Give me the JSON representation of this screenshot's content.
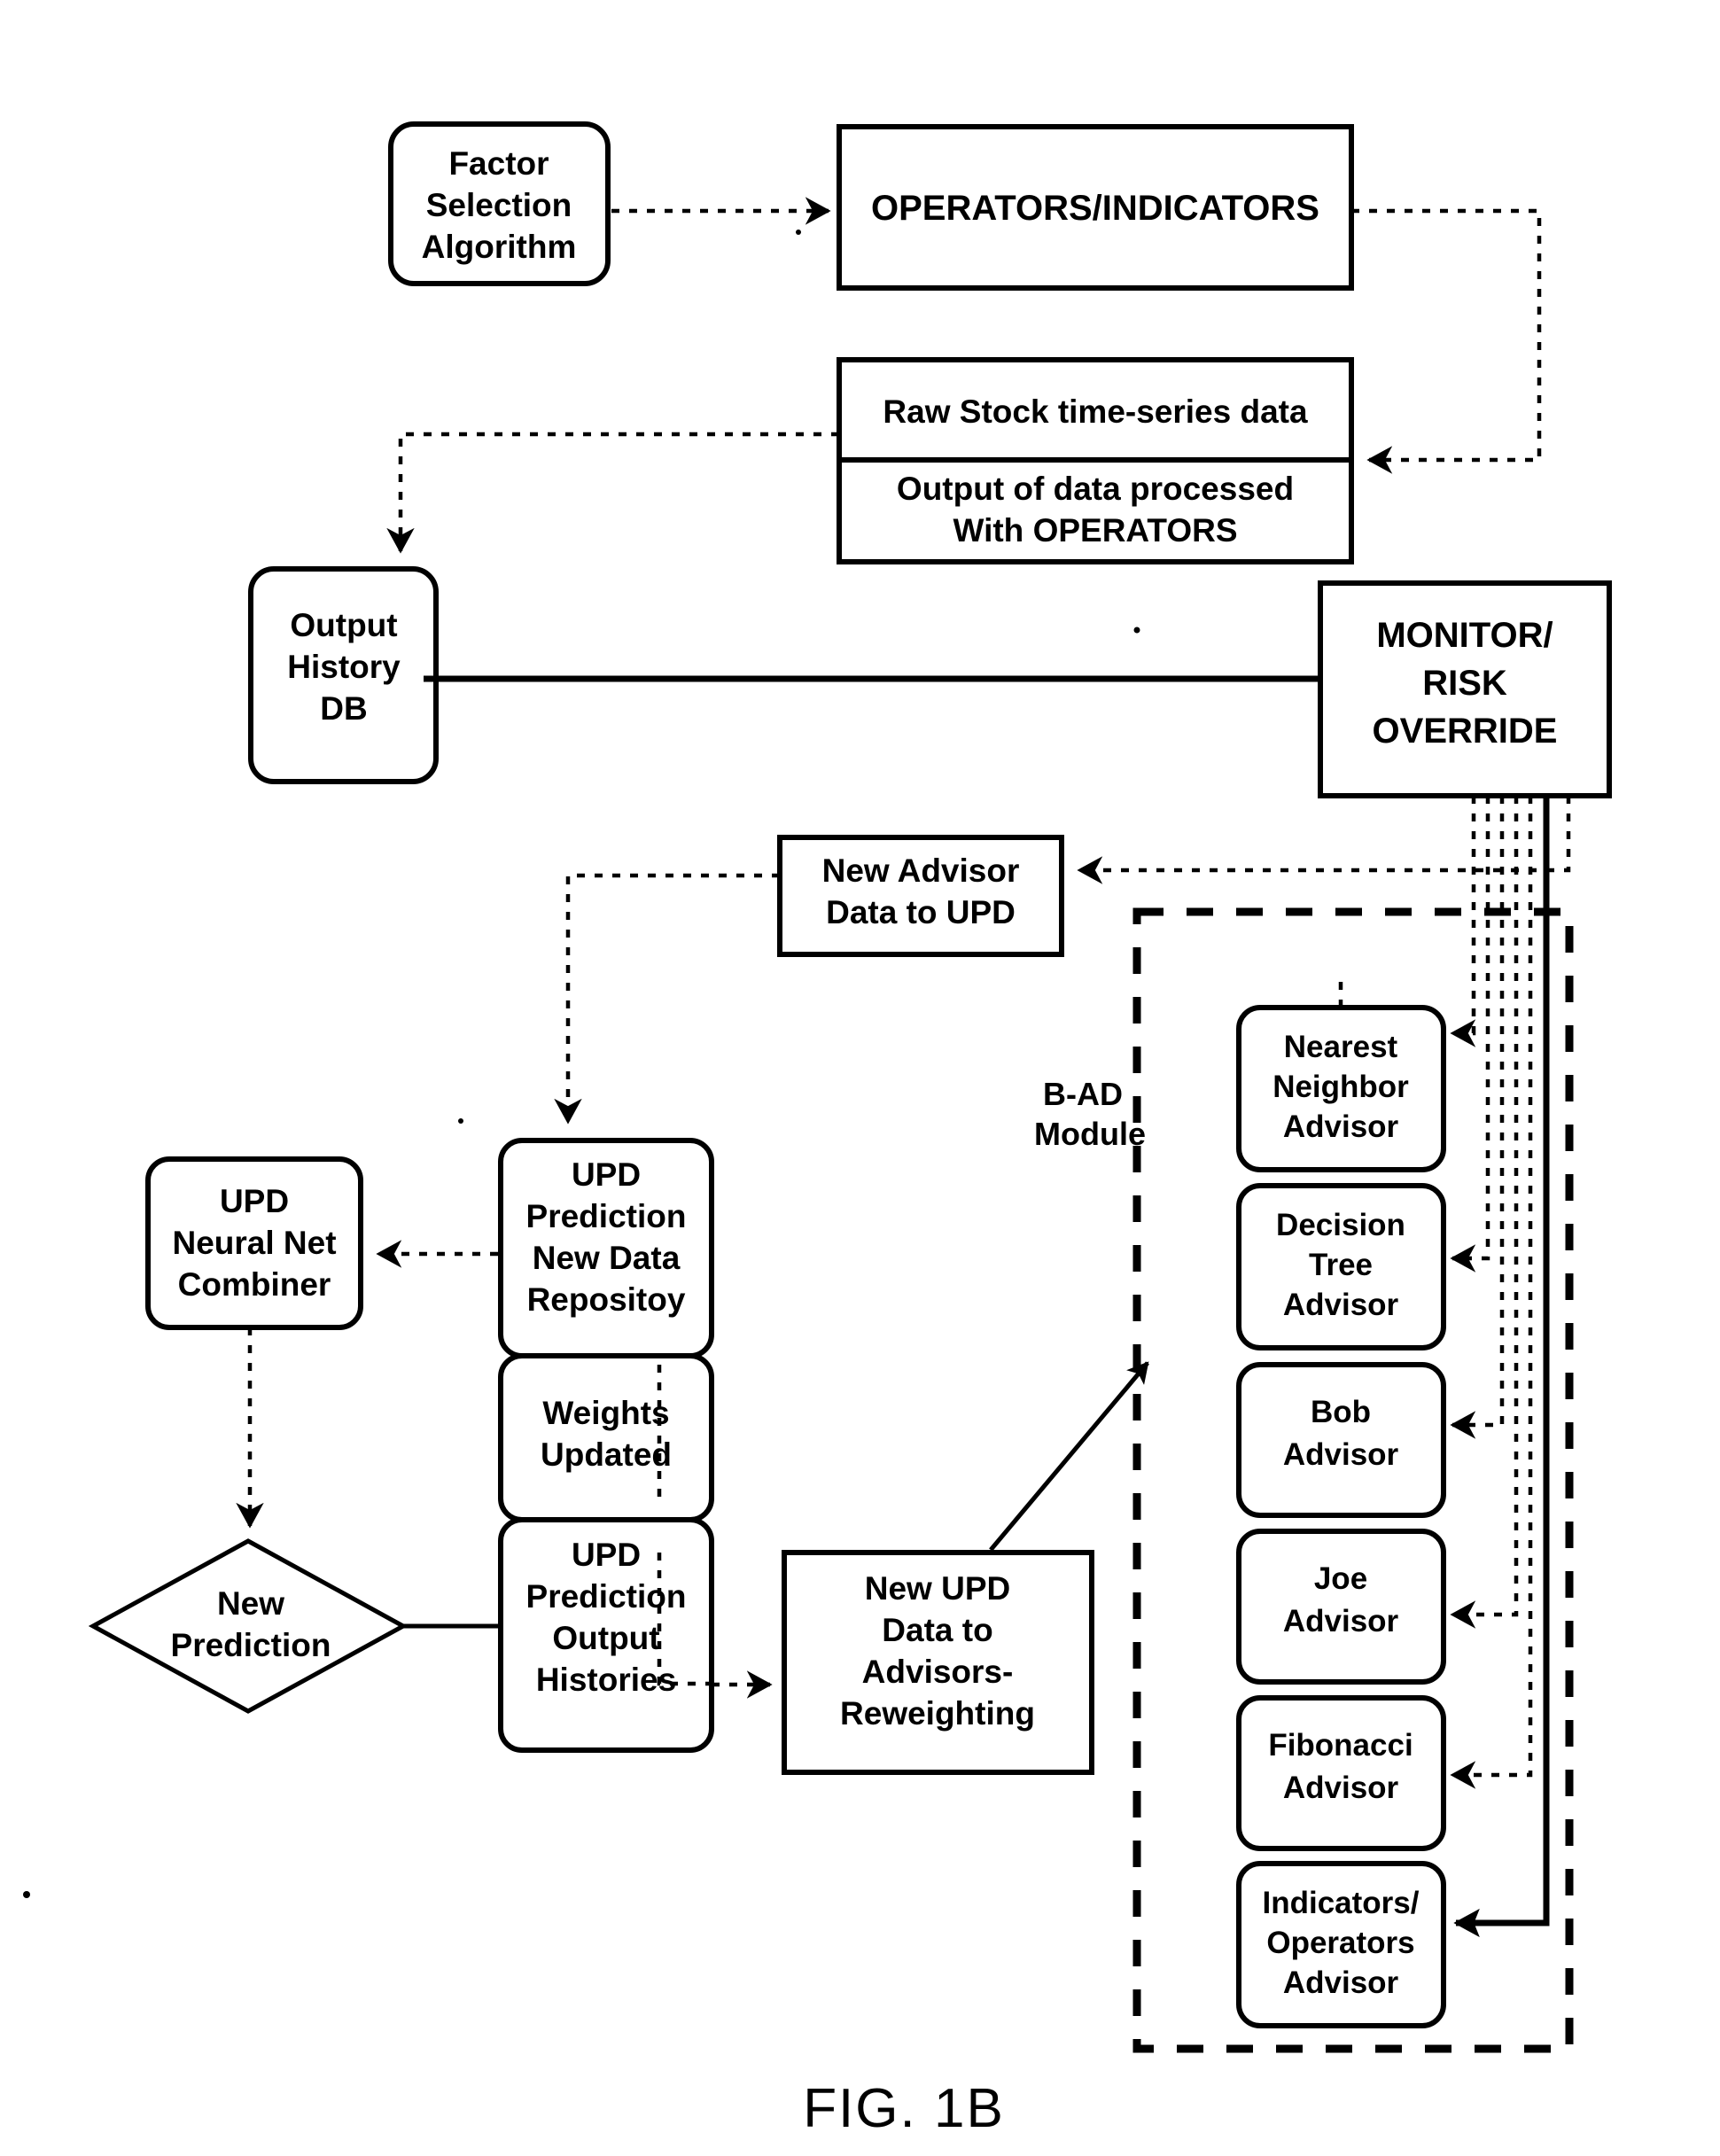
{
  "figure": {
    "caption": "FIG. 1B",
    "group_label_line1": "B-AD",
    "group_label_line2": "Module"
  },
  "nodes": {
    "factor_selection": {
      "lines": [
        "Factor",
        "Selection",
        "Algorithm"
      ]
    },
    "operators_indicators": {
      "lines": [
        "OPERATORS/INDICATORS"
      ]
    },
    "raw_stock": {
      "lines": [
        "Raw Stock time-series data"
      ]
    },
    "processed_output": {
      "lines": [
        "Output of data processed",
        "With OPERATORS"
      ]
    },
    "output_history_db": {
      "lines": [
        "Output",
        "History",
        "DB"
      ]
    },
    "monitor_risk_override": {
      "lines": [
        "MONITOR/",
        "RISK",
        "OVERRIDE"
      ]
    },
    "new_advisor_data": {
      "lines": [
        "New Advisor",
        "Data to UPD"
      ]
    },
    "upd_neural_net": {
      "lines": [
        "UPD",
        "Neural Net",
        "Combiner"
      ]
    },
    "upd_new_data_repo": {
      "lines": [
        "UPD",
        "Prediction",
        "New Data",
        "Repositoy"
      ]
    },
    "weights_updated": {
      "lines": [
        "Weights",
        "Updated"
      ]
    },
    "upd_output_histories": {
      "lines": [
        "UPD",
        "Prediction",
        "Output",
        "Histories"
      ]
    },
    "new_prediction": {
      "lines": [
        "New",
        "Prediction"
      ]
    },
    "new_upd_to_advisors": {
      "lines": [
        "New UPD",
        "Data to",
        "Advisors-",
        "Reweighting"
      ]
    }
  },
  "advisors": [
    {
      "lines": [
        "Nearest",
        "Neighbor",
        "Advisor"
      ]
    },
    {
      "lines": [
        "Decision",
        "Tree",
        "Advisor"
      ]
    },
    {
      "lines": [
        "Bob",
        "Advisor"
      ]
    },
    {
      "lines": [
        "Joe",
        "Advisor"
      ]
    },
    {
      "lines": [
        "Fibonacci",
        "Advisor"
      ]
    },
    {
      "lines": [
        "Indicators/",
        "Operators",
        "Advisor"
      ]
    }
  ],
  "colors": {
    "ink": "#000000",
    "paper": "#ffffff"
  },
  "chart_data": {
    "type": "diagram",
    "title": "FIG. 1B",
    "description": "Block flow diagram of a stock prediction system with advisor modules",
    "edges": [
      {
        "from": "factor_selection",
        "to": "operators_indicators",
        "style": "dotted",
        "arrow": true
      },
      {
        "from": "operators_indicators",
        "to": "processed_output",
        "style": "dotted",
        "arrow": true
      },
      {
        "from": "raw_stock",
        "to": "output_history_db",
        "style": "dotted",
        "arrow": true
      },
      {
        "from": "output_history_db",
        "to": "monitor_risk_override",
        "style": "solid",
        "arrow": false
      },
      {
        "from": "monitor_risk_override",
        "to": "new_advisor_data",
        "style": "dotted",
        "arrow": true
      },
      {
        "from": "new_advisor_data",
        "to": "upd_new_data_repo",
        "style": "dotted",
        "arrow": true
      },
      {
        "from": "upd_new_data_repo",
        "to": "upd_neural_net",
        "style": "dotted",
        "arrow": true
      },
      {
        "from": "upd_neural_net",
        "to": "new_prediction",
        "style": "dotted",
        "arrow": true
      },
      {
        "from": "new_prediction",
        "to": "upd_output_histories",
        "style": "solid-thin",
        "arrow": false
      },
      {
        "from": "upd_output_histories",
        "to": "new_upd_to_advisors",
        "style": "dotted",
        "arrow": true
      },
      {
        "from": "new_upd_to_advisors",
        "to": "advisor-bob",
        "style": "solid-thin",
        "arrow": true
      },
      {
        "from": "monitor_risk_override",
        "to": "advisor-nearest-neighbor",
        "style": "dotted",
        "arrow": true
      },
      {
        "from": "monitor_risk_override",
        "to": "advisor-decision-tree",
        "style": "dotted",
        "arrow": true
      },
      {
        "from": "monitor_risk_override",
        "to": "advisor-bob",
        "style": "dotted",
        "arrow": true
      },
      {
        "from": "monitor_risk_override",
        "to": "advisor-joe",
        "style": "dotted",
        "arrow": true
      },
      {
        "from": "monitor_risk_override",
        "to": "advisor-fibonacci",
        "style": "dotted",
        "arrow": true
      },
      {
        "from": "monitor_risk_override",
        "to": "advisor-indicators-operators",
        "style": "solid",
        "arrow": true
      }
    ]
  }
}
